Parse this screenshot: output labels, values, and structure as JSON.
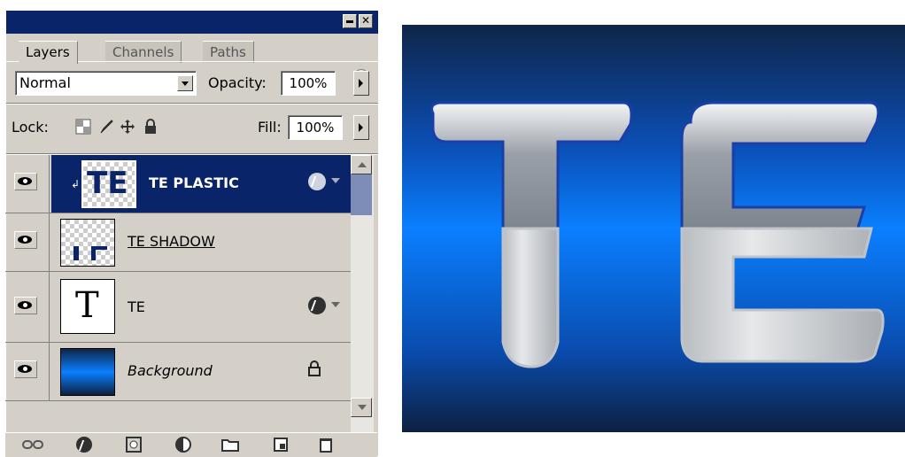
{
  "panel": {
    "tabs": [
      "Layers",
      "Channels",
      "Paths"
    ],
    "blend_mode": "Normal",
    "opacity_label": "Opacity:",
    "opacity_value": "100%",
    "lock_label": "Lock:",
    "fill_label": "Fill:",
    "fill_value": "100%"
  },
  "layers": [
    {
      "name": "TE PLASTIC",
      "selected": true,
      "has_fx": true,
      "thumb_text": "TE"
    },
    {
      "name": "TE SHADOW",
      "selected": false,
      "has_fx": false
    },
    {
      "name": "TE",
      "selected": false,
      "has_fx": true,
      "thumb_text": "T"
    },
    {
      "name": "Background",
      "selected": false,
      "locked": true
    }
  ],
  "canvas": {
    "text": "TE",
    "colors": {
      "background_top": "#0f2548",
      "background_mid": "#0a7fff",
      "letter": "#c8cacc"
    }
  }
}
